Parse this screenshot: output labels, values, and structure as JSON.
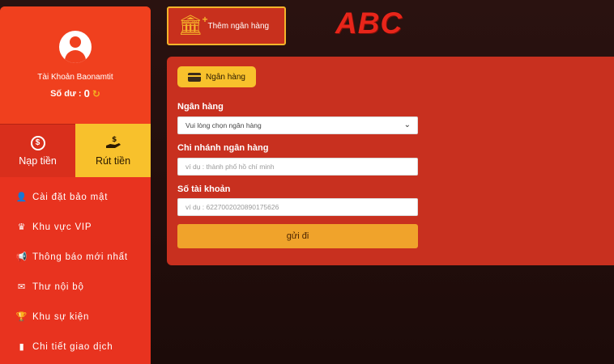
{
  "sidebar": {
    "username": "Tài Khoản Baonamtit",
    "balance_label": "Số dư :",
    "balance_value": "0",
    "tabs": {
      "deposit": "Nạp tiền",
      "withdraw": "Rút tiền"
    },
    "menu": [
      {
        "label": "Cài đặt bảo mật",
        "icon": "user-lock-icon",
        "glyph": "👤"
      },
      {
        "label": "Khu vực VIP",
        "icon": "crown-icon",
        "glyph": "♛"
      },
      {
        "label": "Thông báo mới nhất",
        "icon": "megaphone-icon",
        "glyph": "📢"
      },
      {
        "label": "Thư nội bộ",
        "icon": "envelope-icon",
        "glyph": "✉"
      },
      {
        "label": "Khu sự kiện",
        "icon": "trophy-icon",
        "glyph": "🏆"
      },
      {
        "label": "Chi tiết giao dịch",
        "icon": "document-icon",
        "glyph": "▮"
      }
    ]
  },
  "header": {
    "add_bank_label": "Thêm ngân hàng",
    "logo_text": "ABC"
  },
  "form": {
    "tab_label": "Ngân hàng",
    "bank": {
      "label": "Ngân hàng",
      "selected": "Vui lòng chọn ngân hàng"
    },
    "branch": {
      "label": "Chi nhánh ngân hàng",
      "placeholder": "ví dụ : thành phố hồ chí minh"
    },
    "account": {
      "label": "Số tài khoản",
      "placeholder": "ví dụ : 6227002020890175626"
    },
    "submit_label": "gửi đi"
  },
  "colors": {
    "sidebar": "#e8331f",
    "accent_yellow": "#f8c12c",
    "submit": "#f0a32b",
    "card": "#c8301f",
    "logo": "#e8251a",
    "background": "#1c0b09"
  }
}
